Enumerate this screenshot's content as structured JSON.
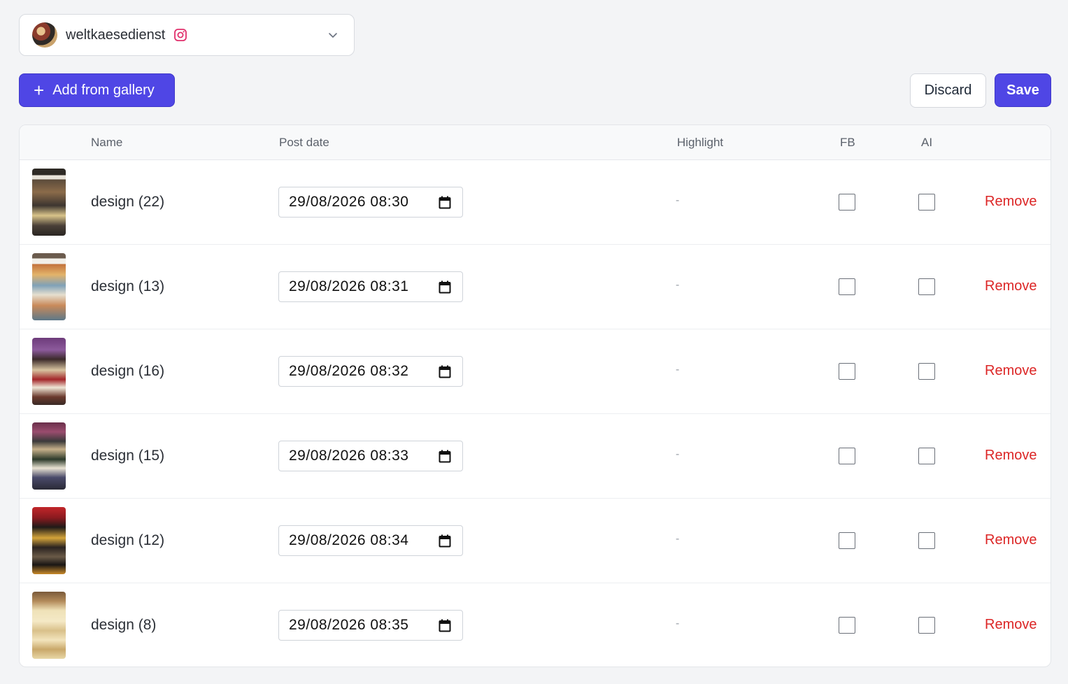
{
  "account": {
    "name": "weltkaesedienst",
    "platform_icon": "instagram-icon",
    "avatar": "account-avatar"
  },
  "toolbar": {
    "add_label": "Add from gallery",
    "discard_label": "Discard",
    "save_label": "Save"
  },
  "table": {
    "columns": {
      "name": "Name",
      "post_date": "Post date",
      "highlight": "Highlight",
      "fb": "FB",
      "ai": "AI"
    },
    "rows": [
      {
        "name": "design (22)",
        "post_date": "29/08/2026 08:30",
        "highlight": "-",
        "fb": false,
        "ai": false,
        "action": "Remove"
      },
      {
        "name": "design (13)",
        "post_date": "29/08/2026 08:31",
        "highlight": "-",
        "fb": false,
        "ai": false,
        "action": "Remove"
      },
      {
        "name": "design (16)",
        "post_date": "29/08/2026 08:32",
        "highlight": "-",
        "fb": false,
        "ai": false,
        "action": "Remove"
      },
      {
        "name": "design (15)",
        "post_date": "29/08/2026 08:33",
        "highlight": "-",
        "fb": false,
        "ai": false,
        "action": "Remove"
      },
      {
        "name": "design (12)",
        "post_date": "29/08/2026 08:34",
        "highlight": "-",
        "fb": false,
        "ai": false,
        "action": "Remove"
      },
      {
        "name": "design (8)",
        "post_date": "29/08/2026 08:35",
        "highlight": "-",
        "fb": false,
        "ai": false,
        "action": "Remove"
      }
    ]
  },
  "colors": {
    "accent": "#4f46e5",
    "danger": "#dc2626",
    "instagram": "#e1306c"
  }
}
